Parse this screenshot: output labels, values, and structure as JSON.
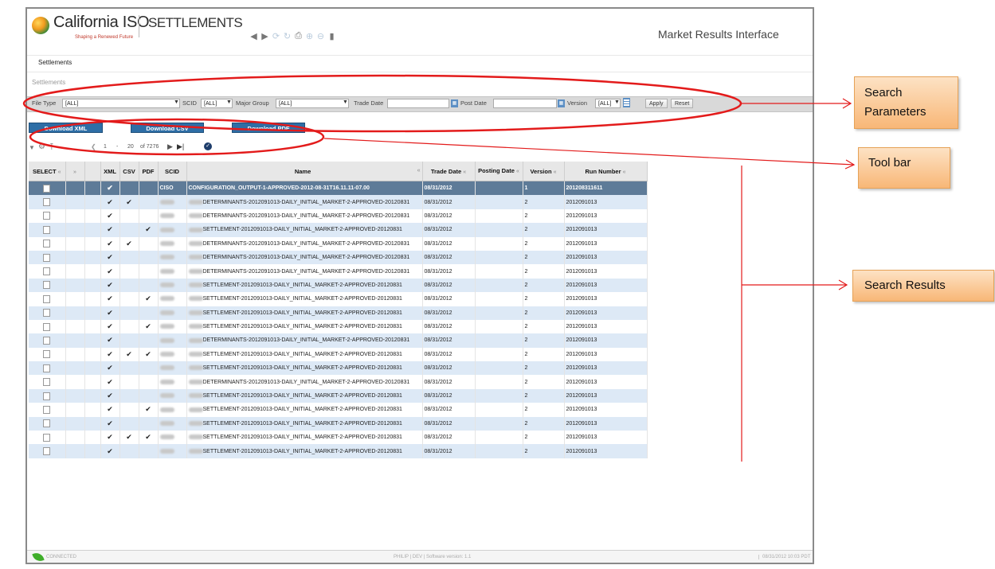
{
  "header": {
    "brand_name": "California ISO",
    "brand_tagline": "Shaping a Renewed Future",
    "module_title": "SETTLEMENTS",
    "right_title": "Market Results Interface",
    "tool_icons": [
      "back-arrow-icon",
      "forward-arrow-icon",
      "refresh-icon",
      "sync-icon",
      "print-icon",
      "zoom-in-icon",
      "zoom-out-icon",
      "chart-icon"
    ]
  },
  "menu": {
    "settlements_label": "Settlements"
  },
  "breadcrumb": "Settlements",
  "search": {
    "file_type_label": "File Type",
    "file_type_value": "[ALL]",
    "scid_label": "SCID",
    "scid_value": "[ALL]",
    "major_group_label": "Major Group",
    "major_group_value": "[ALL]",
    "trade_date_label": "Trade Date",
    "trade_date_value": "",
    "post_date_label": "Post Date",
    "post_date_value": "",
    "version_label": "Version",
    "version_value": "[ALL]",
    "apply_label": "Apply",
    "reset_label": "Reset"
  },
  "downloads": {
    "xml": "Download XML",
    "csv": "Download CSV",
    "pdf": "Download PDF"
  },
  "pager": {
    "from": "1",
    "sep": "-",
    "to": "20",
    "of_text": "of 7276"
  },
  "table": {
    "columns": {
      "select": "SELECT",
      "xml": "XML",
      "csv": "CSV",
      "pdf": "PDF",
      "scid": "SCID",
      "name": "Name",
      "trade_date": "Trade Date",
      "posting_date": "Posting Date",
      "version": "Version",
      "run_number": "Run Number"
    },
    "rows": [
      {
        "xml": true,
        "csv": false,
        "pdf": false,
        "scid": "CISO",
        "name": "CONFIGURATION_OUTPUT-1-APPROVED-2012-08-31T16.11.11-07.00",
        "trade_date": "08/31/2012",
        "posting_date": "",
        "version": "1",
        "run_number": "201208311611",
        "selected": true
      },
      {
        "xml": true,
        "csv": true,
        "pdf": false,
        "name": "DETERMINANTS-2012091013-DAILY_INITIAL_MARKET-2-APPROVED-20120831",
        "trade_date": "08/31/2012",
        "version": "2",
        "run_number": "2012091013"
      },
      {
        "xml": true,
        "csv": false,
        "pdf": false,
        "name": "DETERMINANTS-2012091013-DAILY_INITIAL_MARKET-2-APPROVED-20120831",
        "trade_date": "08/31/2012",
        "version": "2",
        "run_number": "2012091013"
      },
      {
        "xml": true,
        "csv": false,
        "pdf": true,
        "name": "SETTLEMENT-2012091013-DAILY_INITIAL_MARKET-2-APPROVED-20120831",
        "trade_date": "08/31/2012",
        "version": "2",
        "run_number": "2012091013"
      },
      {
        "xml": true,
        "csv": true,
        "pdf": false,
        "name": "DETERMINANTS-2012091013-DAILY_INITIAL_MARKET-2-APPROVED-20120831",
        "trade_date": "08/31/2012",
        "version": "2",
        "run_number": "2012091013"
      },
      {
        "xml": true,
        "csv": false,
        "pdf": false,
        "name": "DETERMINANTS-2012091013-DAILY_INITIAL_MARKET-2-APPROVED-20120831",
        "trade_date": "08/31/2012",
        "version": "2",
        "run_number": "2012091013"
      },
      {
        "xml": true,
        "csv": false,
        "pdf": false,
        "name": "DETERMINANTS-2012091013-DAILY_INITIAL_MARKET-2-APPROVED-20120831",
        "trade_date": "08/31/2012",
        "version": "2",
        "run_number": "2012091013"
      },
      {
        "xml": true,
        "csv": false,
        "pdf": false,
        "name": "SETTLEMENT-2012091013-DAILY_INITIAL_MARKET-2-APPROVED-20120831",
        "trade_date": "08/31/2012",
        "version": "2",
        "run_number": "2012091013"
      },
      {
        "xml": true,
        "csv": false,
        "pdf": true,
        "name": "SETTLEMENT-2012091013-DAILY_INITIAL_MARKET-2-APPROVED-20120831",
        "trade_date": "08/31/2012",
        "version": "2",
        "run_number": "2012091013"
      },
      {
        "xml": true,
        "csv": false,
        "pdf": false,
        "name": "SETTLEMENT-2012091013-DAILY_INITIAL_MARKET-2-APPROVED-20120831",
        "trade_date": "08/31/2012",
        "version": "2",
        "run_number": "2012091013"
      },
      {
        "xml": true,
        "csv": false,
        "pdf": true,
        "name": "SETTLEMENT-2012091013-DAILY_INITIAL_MARKET-2-APPROVED-20120831",
        "trade_date": "08/31/2012",
        "version": "2",
        "run_number": "2012091013"
      },
      {
        "xml": true,
        "csv": false,
        "pdf": false,
        "name": "DETERMINANTS-2012091013-DAILY_INITIAL_MARKET-2-APPROVED-20120831",
        "trade_date": "08/31/2012",
        "version": "2",
        "run_number": "2012091013"
      },
      {
        "xml": true,
        "csv": true,
        "pdf": true,
        "name": "SETTLEMENT-2012091013-DAILY_INITIAL_MARKET-2-APPROVED-20120831",
        "trade_date": "08/31/2012",
        "version": "2",
        "run_number": "2012091013"
      },
      {
        "xml": true,
        "csv": false,
        "pdf": false,
        "name": "SETTLEMENT-2012091013-DAILY_INITIAL_MARKET-2-APPROVED-20120831",
        "trade_date": "08/31/2012",
        "version": "2",
        "run_number": "2012091013"
      },
      {
        "xml": true,
        "csv": false,
        "pdf": false,
        "name": "DETERMINANTS-2012091013-DAILY_INITIAL_MARKET-2-APPROVED-20120831",
        "trade_date": "08/31/2012",
        "version": "2",
        "run_number": "2012091013"
      },
      {
        "xml": true,
        "csv": false,
        "pdf": false,
        "name": "SETTLEMENT-2012091013-DAILY_INITIAL_MARKET-2-APPROVED-20120831",
        "trade_date": "08/31/2012",
        "version": "2",
        "run_number": "2012091013"
      },
      {
        "xml": true,
        "csv": false,
        "pdf": true,
        "name": "SETTLEMENT-2012091013-DAILY_INITIAL_MARKET-2-APPROVED-20120831",
        "trade_date": "08/31/2012",
        "version": "2",
        "run_number": "2012091013"
      },
      {
        "xml": true,
        "csv": false,
        "pdf": false,
        "name": "SETTLEMENT-2012091013-DAILY_INITIAL_MARKET-2-APPROVED-20120831",
        "trade_date": "08/31/2012",
        "version": "2",
        "run_number": "2012091013"
      },
      {
        "xml": true,
        "csv": true,
        "pdf": true,
        "name": "SETTLEMENT-2012091013-DAILY_INITIAL_MARKET-2-APPROVED-20120831",
        "trade_date": "08/31/2012",
        "version": "2",
        "run_number": "2012091013"
      },
      {
        "xml": true,
        "csv": false,
        "pdf": false,
        "name": "SETTLEMENT-2012091013-DAILY_INITIAL_MARKET-2-APPROVED-20120831",
        "trade_date": "08/31/2012",
        "version": "2",
        "run_number": "2012091013"
      }
    ]
  },
  "status": {
    "connected": "CONNECTED",
    "center": "PHILIP  |  DEV  |  Software version: 1.1",
    "datetime": "08/31/2012 10:03 PDT"
  },
  "callouts": {
    "search_parameters": "Search Parameters",
    "toolbar": "Tool bar",
    "search_results": "Search Results"
  },
  "colors": {
    "highlight_ellipse": "#e31b1b",
    "callout_fill": "#f8b777",
    "selected_row": "#5e7b98",
    "alt_row": "#dde9f6",
    "download_button": "#2e6ea6"
  }
}
